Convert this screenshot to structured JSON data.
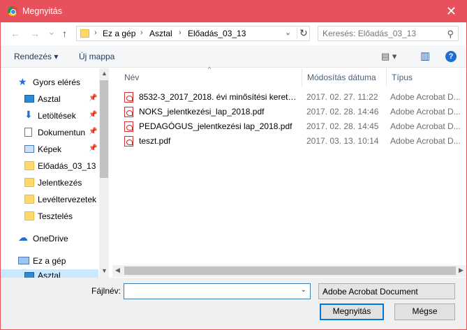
{
  "window": {
    "title": "Megnyitás",
    "accent": "#e8505b"
  },
  "nav": {
    "back": "←",
    "forward": "→",
    "recent": "⌄",
    "up": "↑"
  },
  "address": {
    "crumbs": [
      "Ez a gép",
      "Asztal",
      "Előadás_03_13"
    ],
    "separator": "›"
  },
  "search": {
    "placeholder": "Keresés: Előadás_03_13"
  },
  "toolbar": {
    "organize": "Rendezés ▾",
    "new_folder": "Új mappa",
    "view_icons": "▤ ▾",
    "preview_icon": "▥",
    "help": "?"
  },
  "sidebar": {
    "items": [
      {
        "label": "Gyors elérés",
        "icon": "star-icon",
        "pinned": false
      },
      {
        "label": "Asztal",
        "icon": "desktop-icon",
        "pinned": true
      },
      {
        "label": "Letöltések",
        "icon": "download-icon",
        "pinned": true
      },
      {
        "label": "Dokumentun",
        "icon": "document-icon",
        "pinned": true
      },
      {
        "label": "Képek",
        "icon": "pictures-icon",
        "pinned": true
      },
      {
        "label": "Előadás_03_13",
        "icon": "folder-icon",
        "pinned": false
      },
      {
        "label": "Jelentkezés",
        "icon": "folder-icon",
        "pinned": false
      },
      {
        "label": "Levéltervezetek",
        "icon": "folder-icon",
        "pinned": false
      },
      {
        "label": "Tesztelés",
        "icon": "folder-icon",
        "pinned": false
      },
      {
        "label": "OneDrive",
        "icon": "cloud-icon",
        "pinned": false
      },
      {
        "label": "Ez a gép",
        "icon": "computer-icon",
        "pinned": false
      },
      {
        "label": "Asztal",
        "icon": "desktop-icon",
        "pinned": false
      }
    ]
  },
  "files": {
    "columns": [
      "Név",
      "Módosítás dátuma",
      "Típus"
    ],
    "rows": [
      {
        "name": "8532-3_2017_2018. évi minősítési keretszá...",
        "date": "2017. 02. 27. 11:22",
        "type": "Adobe Acrobat D..."
      },
      {
        "name": "NOKS_jelentkezési_lap_2018.pdf",
        "date": "2017. 02. 28. 14:46",
        "type": "Adobe Acrobat D..."
      },
      {
        "name": "PEDAGÓGUS_jelentkezési lap_2018.pdf",
        "date": "2017. 02. 28. 14:45",
        "type": "Adobe Acrobat D..."
      },
      {
        "name": "teszt.pdf",
        "date": "2017. 03. 13. 10:14",
        "type": "Adobe Acrobat D..."
      }
    ]
  },
  "bottom": {
    "filename_label": "Fájlnév:",
    "filename_value": "",
    "filetype": "Adobe Acrobat Document",
    "open_label": "Megnyitás",
    "cancel_label": "Mégse"
  }
}
